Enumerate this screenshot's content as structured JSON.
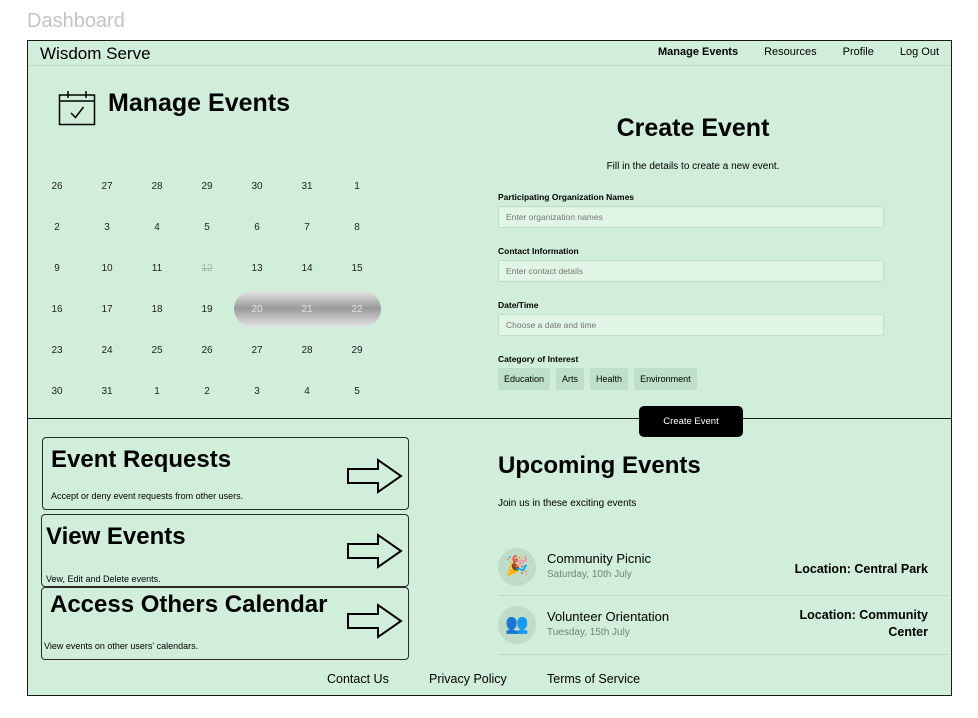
{
  "page": {
    "label": "Dashboard"
  },
  "header": {
    "brand": "Wisdom Serve",
    "nav": [
      {
        "label": "Manage Events",
        "active": true
      },
      {
        "label": "Resources"
      },
      {
        "label": "Profile"
      },
      {
        "label": "Log Out"
      }
    ]
  },
  "manage": {
    "title": "Manage Events",
    "icon": "calendar-check-icon"
  },
  "calendar": {
    "weeks": [
      [
        "26",
        "27",
        "28",
        "29",
        "30",
        "31",
        "1"
      ],
      [
        "2",
        "3",
        "4",
        "5",
        "6",
        "7",
        "8"
      ],
      [
        "9",
        "10",
        "11",
        "12",
        "13",
        "14",
        "15"
      ],
      [
        "16",
        "17",
        "18",
        "19",
        "20",
        "21",
        "22"
      ],
      [
        "23",
        "24",
        "25",
        "26",
        "27",
        "28",
        "29"
      ],
      [
        "30",
        "31",
        "1",
        "2",
        "3",
        "4",
        "5"
      ]
    ],
    "struck": [
      "12"
    ],
    "highlighted": [
      "20",
      "21",
      "22"
    ]
  },
  "create": {
    "title": "Create Event",
    "subtitle": "Fill in the details to create a new event.",
    "fields": [
      {
        "label": "Participating Organization Names",
        "placeholder": "Enter organization names"
      },
      {
        "label": "Contact Information",
        "placeholder": "Enter contact details"
      },
      {
        "label": "Date/Time",
        "placeholder": "Choose a date and time"
      }
    ],
    "category_label": "Category of Interest",
    "categories": [
      "Education",
      "Arts",
      "Health",
      "Environment"
    ],
    "button": "Create Event"
  },
  "cards": [
    {
      "title": "Event Requests",
      "desc": "Accept or deny event requests from other users.",
      "icon": "arrow-right-icon"
    },
    {
      "title": "View Events",
      "desc": "Vew, Edit and Delete events.",
      "icon": "arrow-right-icon"
    },
    {
      "title": "Access Others Calendar",
      "desc": "View events on other users' calendars.",
      "icon": "arrow-right-icon"
    }
  ],
  "upcoming": {
    "title": "Upcoming Events",
    "subtitle": "Join us in these exciting events",
    "events": [
      {
        "name": "Community Picnic",
        "date": "Saturday, 10th July",
        "location": "Location: Central Park",
        "icon": "party-popper-icon",
        "glyph": "🎉"
      },
      {
        "name": "Volunteer Orientation",
        "date": "Tuesday, 15th July",
        "location": "Location: Community Center",
        "icon": "people-icon",
        "glyph": "👥"
      }
    ]
  },
  "footer": {
    "links": [
      "Contact Us",
      "Privacy Policy",
      "Terms of Service"
    ]
  },
  "colors": {
    "background": "#d1eedb",
    "input": "#e1f5e6",
    "chip": "#bfe0c8",
    "button": "#000000",
    "muted": "#6e8575"
  }
}
